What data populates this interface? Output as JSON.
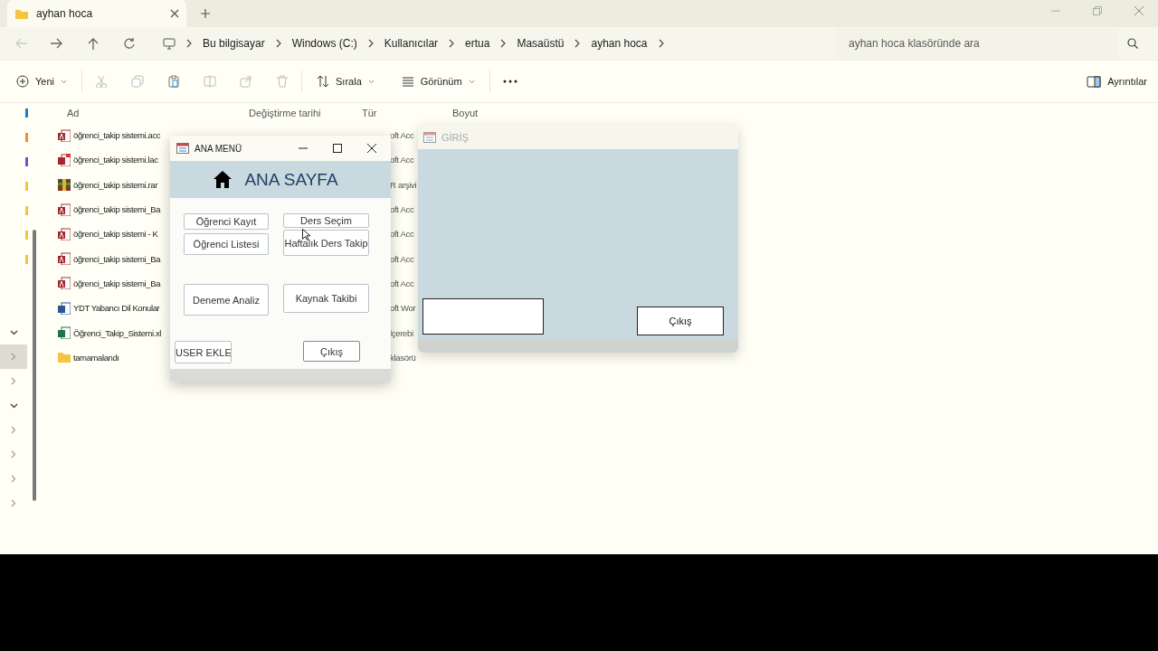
{
  "explorer": {
    "tab": {
      "title": "ayhan hoca"
    },
    "breadcrumb": [
      "Bu bilgisayar",
      "Windows (C:)",
      "Kullanıcılar",
      "ertua",
      "Masaüstü",
      "ayhan hoca"
    ],
    "search": {
      "placeholder": "ayhan hoca klasöründe ara"
    },
    "toolbar": {
      "new": "Yeni",
      "sort": "Sırala",
      "view": "Görünüm",
      "details": "Ayrıntılar"
    },
    "columns": [
      "Ad",
      "Değiştirme tarihi",
      "Tür",
      "Boyut"
    ],
    "nav": [
      {
        "expanded": true,
        "selected": false
      },
      {
        "expanded": false,
        "selected": true
      },
      {
        "expanded": false,
        "selected": false
      },
      {
        "expanded": true,
        "selected": false
      },
      {
        "expanded": false,
        "selected": false
      },
      {
        "expanded": false,
        "selected": false
      },
      {
        "expanded": false,
        "selected": false
      },
      {
        "expanded": false,
        "selected": false
      }
    ],
    "files": [
      {
        "kind": "access",
        "name": "öğrenci_takip sistemi.acc",
        "type": "oft Acc"
      },
      {
        "kind": "lock",
        "name": "öğrenci_takip sistemi.lac",
        "type": "oft Acc"
      },
      {
        "kind": "archive",
        "name": "öğrenci_takip sistemi.rar",
        "type": "R arşivi"
      },
      {
        "kind": "access",
        "name": "öğrenci_takip sistemi_Ba",
        "type": "oft Acc"
      },
      {
        "kind": "access",
        "name": "öğrenci_takip sistemi - K",
        "type": "oft Acc"
      },
      {
        "kind": "access",
        "name": "öğrenci_takip sistemi_Ba",
        "type": "oft Acc"
      },
      {
        "kind": "access",
        "name": "öğrenci_takip sistemi_Ba",
        "type": "oft Acc"
      },
      {
        "kind": "word",
        "name": "YDT Yabancı Dil Konular",
        "type": "oft Wor"
      },
      {
        "kind": "excel",
        "name": "Öğrenci_Takip_Sistemi.xl",
        "type": "lçerebi"
      },
      {
        "kind": "folder",
        "name": "tamamalandı",
        "type": "klasörü"
      }
    ]
  },
  "main_menu": {
    "title": "ANA MENÜ",
    "heading": "ANA SAYFA",
    "buttons": [
      "Öğrenci Kayıt",
      "Ders Seçim",
      "Öğrenci Listesi",
      "Haftalık Ders Takip",
      "Deneme Analiz",
      "Kaynak Takibi",
      "USER EKLE",
      "Çıkış"
    ]
  },
  "login": {
    "title": "GİRİŞ",
    "exit": "Çıkış"
  }
}
